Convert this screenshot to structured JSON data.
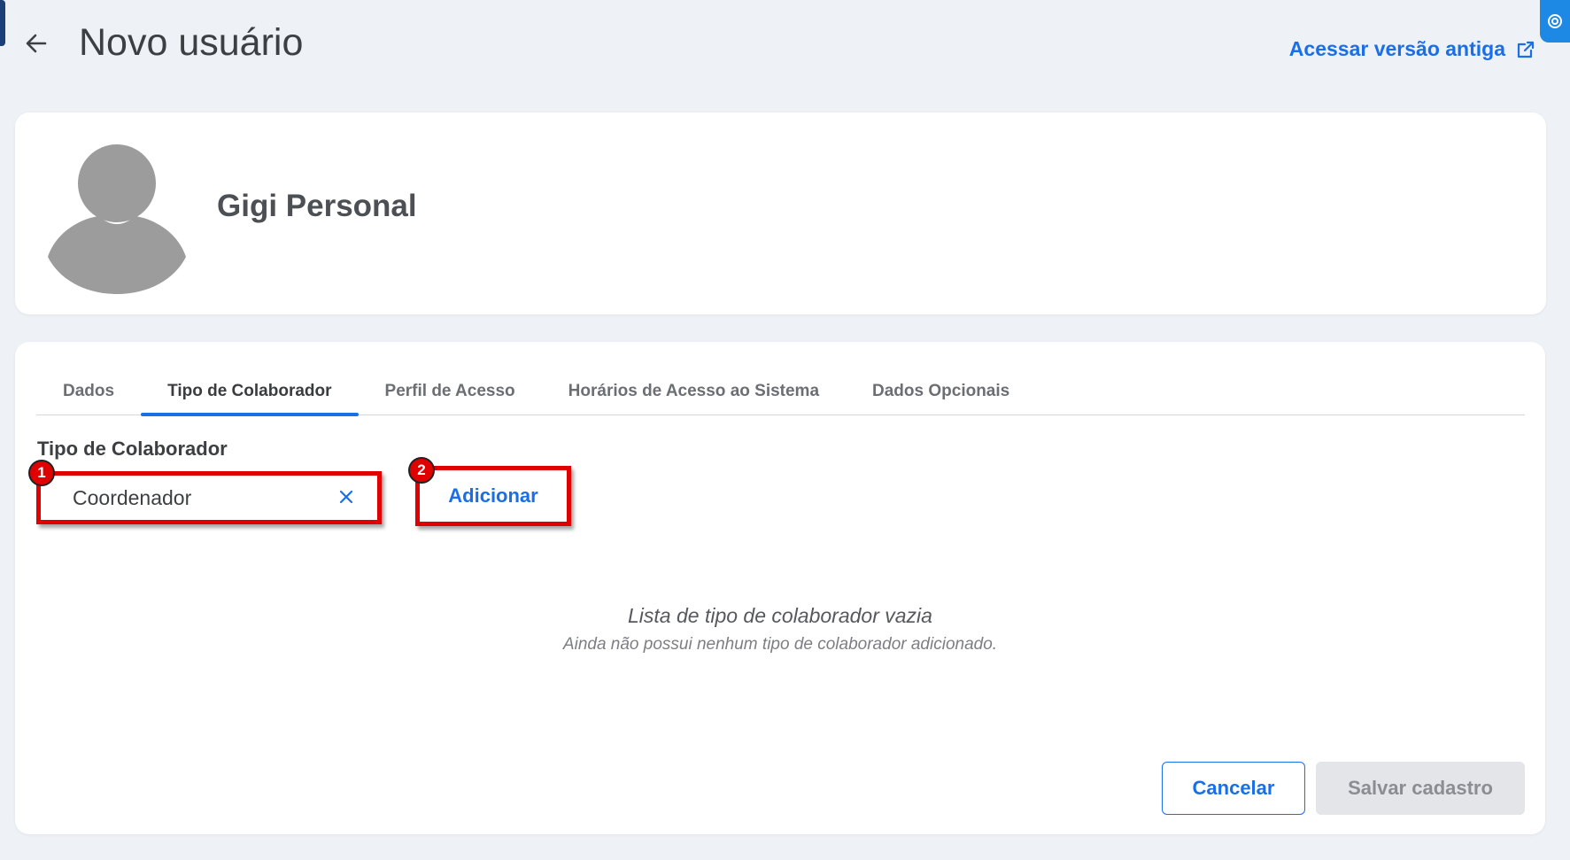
{
  "header": {
    "title": "Novo usuário",
    "old_version_link": "Acessar versão antiga"
  },
  "profile": {
    "name": "Gigi Personal"
  },
  "tabs": [
    {
      "label": "Dados",
      "active": false
    },
    {
      "label": "Tipo de Colaborador",
      "active": true
    },
    {
      "label": "Perfil de Acesso",
      "active": false
    },
    {
      "label": "Horários de Acesso ao Sistema",
      "active": false
    },
    {
      "label": "Dados Opcionais",
      "active": false
    }
  ],
  "form": {
    "field_label": "Tipo de Colaborador",
    "selected_value": "Coordenador",
    "add_button": "Adicionar"
  },
  "annotations": {
    "badge_1": "1",
    "badge_2": "2"
  },
  "empty_state": {
    "title": "Lista de tipo de colaborador vazia",
    "subtitle": "Ainda não possui nenhum tipo de colaborador adicionado."
  },
  "actions": {
    "cancel": "Cancelar",
    "save": "Salvar cadastro"
  },
  "colors": {
    "accent": "#1a6fe8",
    "annotation": "#e00000",
    "background": "#eef1f6"
  }
}
